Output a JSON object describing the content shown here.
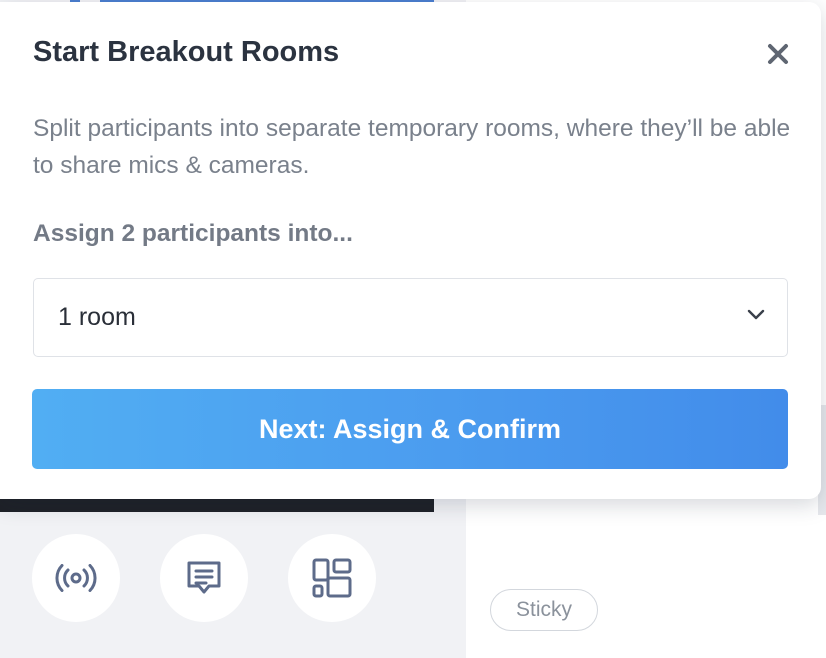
{
  "modal": {
    "title": "Start Breakout Rooms",
    "close_icon": "close-icon",
    "description": "Split participants into separate temporary rooms, where they’ll be able to share mics & cameras.",
    "assign_label": "Assign 2 participants into...",
    "room_select": {
      "value": "1 room",
      "icon": "chevron-down-icon"
    },
    "next_button_label": "Next: Assign & Confirm"
  },
  "toolbar": {
    "buttons": [
      {
        "icon": "broadcast-icon"
      },
      {
        "icon": "chat-icon"
      },
      {
        "icon": "layout-grid-icon"
      }
    ]
  },
  "board": {
    "sticky_chip_label": "Sticky"
  },
  "colors": {
    "title": "#2b3340",
    "description": "#7a818c",
    "button_gradient_start": "#51aef3",
    "button_gradient_end": "#428cea",
    "button_text": "#ffffff",
    "icon": "#5d6b8a"
  }
}
